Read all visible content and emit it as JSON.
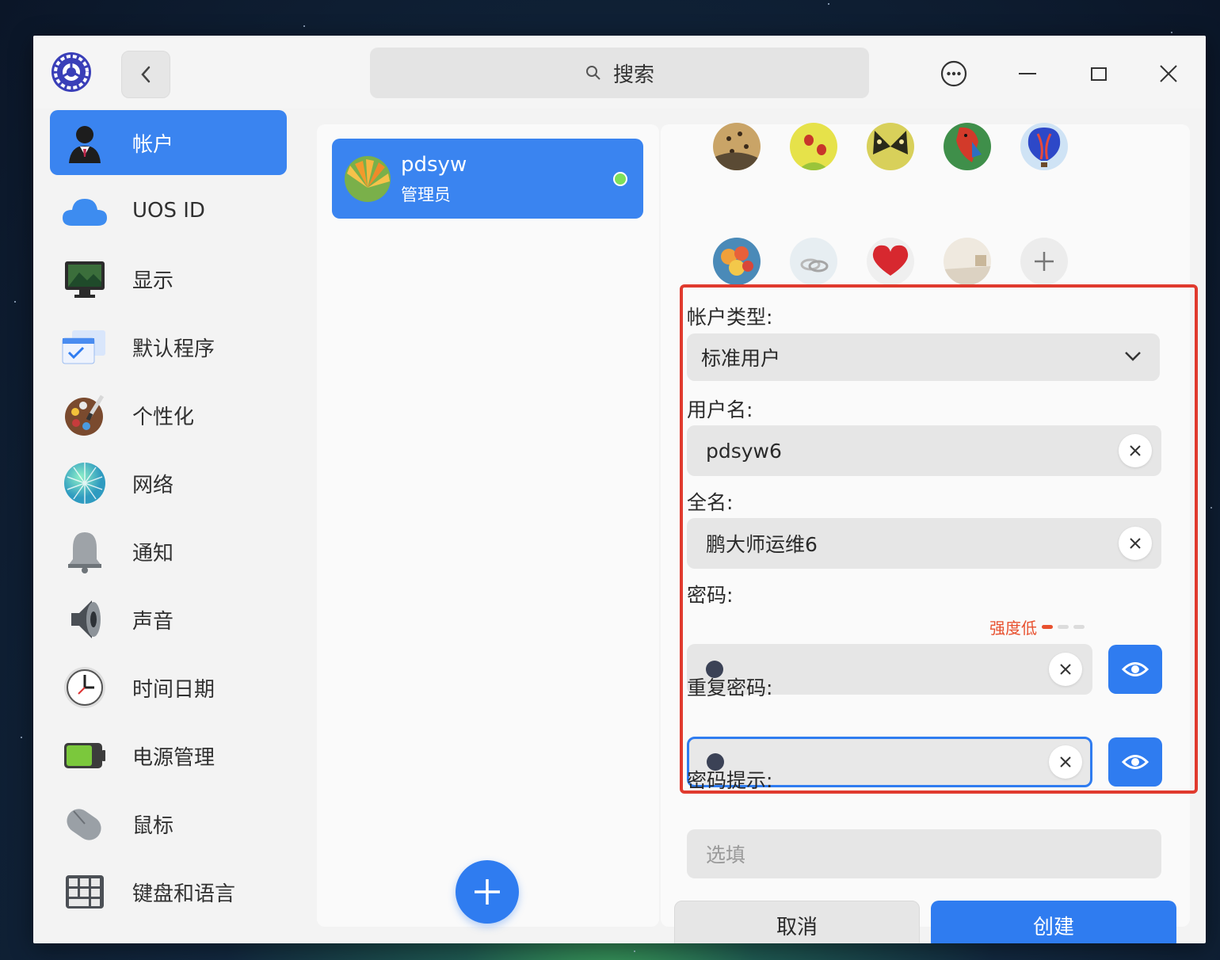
{
  "window": {
    "search_placeholder": "搜索"
  },
  "sidebar": {
    "items": [
      {
        "label": "帐户",
        "icon": "account-icon",
        "active": true
      },
      {
        "label": "UOS ID",
        "icon": "cloud-icon",
        "active": false
      },
      {
        "label": "显示",
        "icon": "display-icon",
        "active": false
      },
      {
        "label": "默认程序",
        "icon": "default-apps-icon",
        "active": false
      },
      {
        "label": "个性化",
        "icon": "palette-icon",
        "active": false
      },
      {
        "label": "网络",
        "icon": "network-icon",
        "active": false
      },
      {
        "label": "通知",
        "icon": "bell-icon",
        "active": false
      },
      {
        "label": "声音",
        "icon": "speaker-icon",
        "active": false
      },
      {
        "label": "时间日期",
        "icon": "clock-icon",
        "active": false
      },
      {
        "label": "电源管理",
        "icon": "battery-icon",
        "active": false
      },
      {
        "label": "鼠标",
        "icon": "mouse-icon",
        "active": false
      },
      {
        "label": "键盘和语言",
        "icon": "keyboard-icon",
        "active": false
      }
    ]
  },
  "user_list": {
    "users": [
      {
        "name": "pdsyw",
        "role": "管理员",
        "online": true
      }
    ]
  },
  "form": {
    "account_type_label": "帐户类型:",
    "account_type_value": "标准用户",
    "username_label": "用户名:",
    "username_value": "pdsyw6",
    "fullname_label": "全名:",
    "fullname_value": "鹏大师运维6",
    "password_label": "密码:",
    "password_strength": "强度低",
    "repeat_password_label": "重复密码:",
    "hint_label": "密码提示:",
    "hint_placeholder": "选填",
    "cancel_label": "取消",
    "create_label": "创建"
  },
  "colors": {
    "accent": "#2f7cf0",
    "warning": "#e8512f",
    "online": "#7de05a"
  }
}
